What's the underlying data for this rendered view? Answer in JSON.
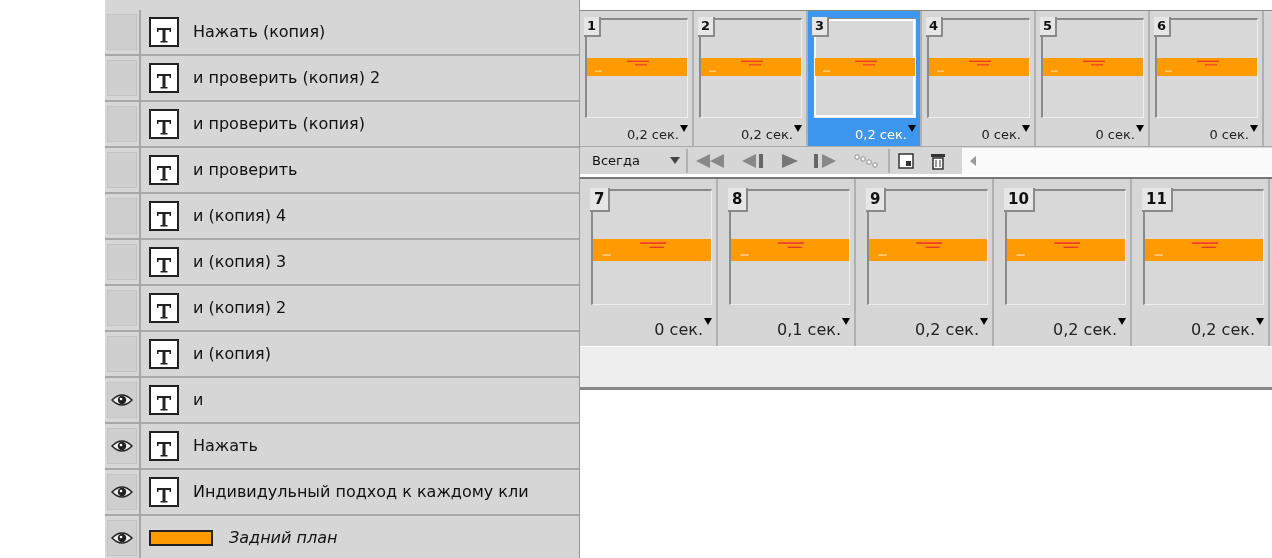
{
  "layers": [
    {
      "name": "Нажать (копия)",
      "kind": "text",
      "visible": false
    },
    {
      "name": "и проверить (копия) 2",
      "kind": "text",
      "visible": false
    },
    {
      "name": "и проверить (копия)",
      "kind": "text",
      "visible": false
    },
    {
      "name": "и проверить",
      "kind": "text",
      "visible": false
    },
    {
      "name": "и (копия) 4",
      "kind": "text",
      "visible": false
    },
    {
      "name": "и (копия) 3",
      "kind": "text",
      "visible": false
    },
    {
      "name": "и (копия) 2",
      "kind": "text",
      "visible": false
    },
    {
      "name": "и (копия)",
      "kind": "text",
      "visible": false
    },
    {
      "name": "и",
      "kind": "text",
      "visible": true
    },
    {
      "name": "Нажать",
      "kind": "text",
      "visible": true
    },
    {
      "name": "Индивидульный подход к каждому кли",
      "kind": "text",
      "visible": true
    },
    {
      "name": "Задний план",
      "kind": "fill",
      "visible": true
    }
  ],
  "animation": {
    "frames": [
      {
        "number": "1",
        "delay": "0,2 сек.",
        "selected": false
      },
      {
        "number": "2",
        "delay": "0,2 сек.",
        "selected": false
      },
      {
        "number": "3",
        "delay": "0,2 сек.",
        "selected": true
      },
      {
        "number": "4",
        "delay": "0 сек.",
        "selected": false
      },
      {
        "number": "5",
        "delay": "0 сек.",
        "selected": false
      },
      {
        "number": "6",
        "delay": "0 сек.",
        "selected": false
      }
    ],
    "loop": "Всегда"
  },
  "animation_2": {
    "frames": [
      {
        "number": "7",
        "delay": "0 сек.",
        "selected": false
      },
      {
        "number": "8",
        "delay": "0,1 сек.",
        "selected": false
      },
      {
        "number": "9",
        "delay": "0,2 сек.",
        "selected": false
      },
      {
        "number": "10",
        "delay": "0,2 сек.",
        "selected": false
      },
      {
        "number": "11",
        "delay": "0,2 сек.",
        "selected": false
      }
    ]
  }
}
